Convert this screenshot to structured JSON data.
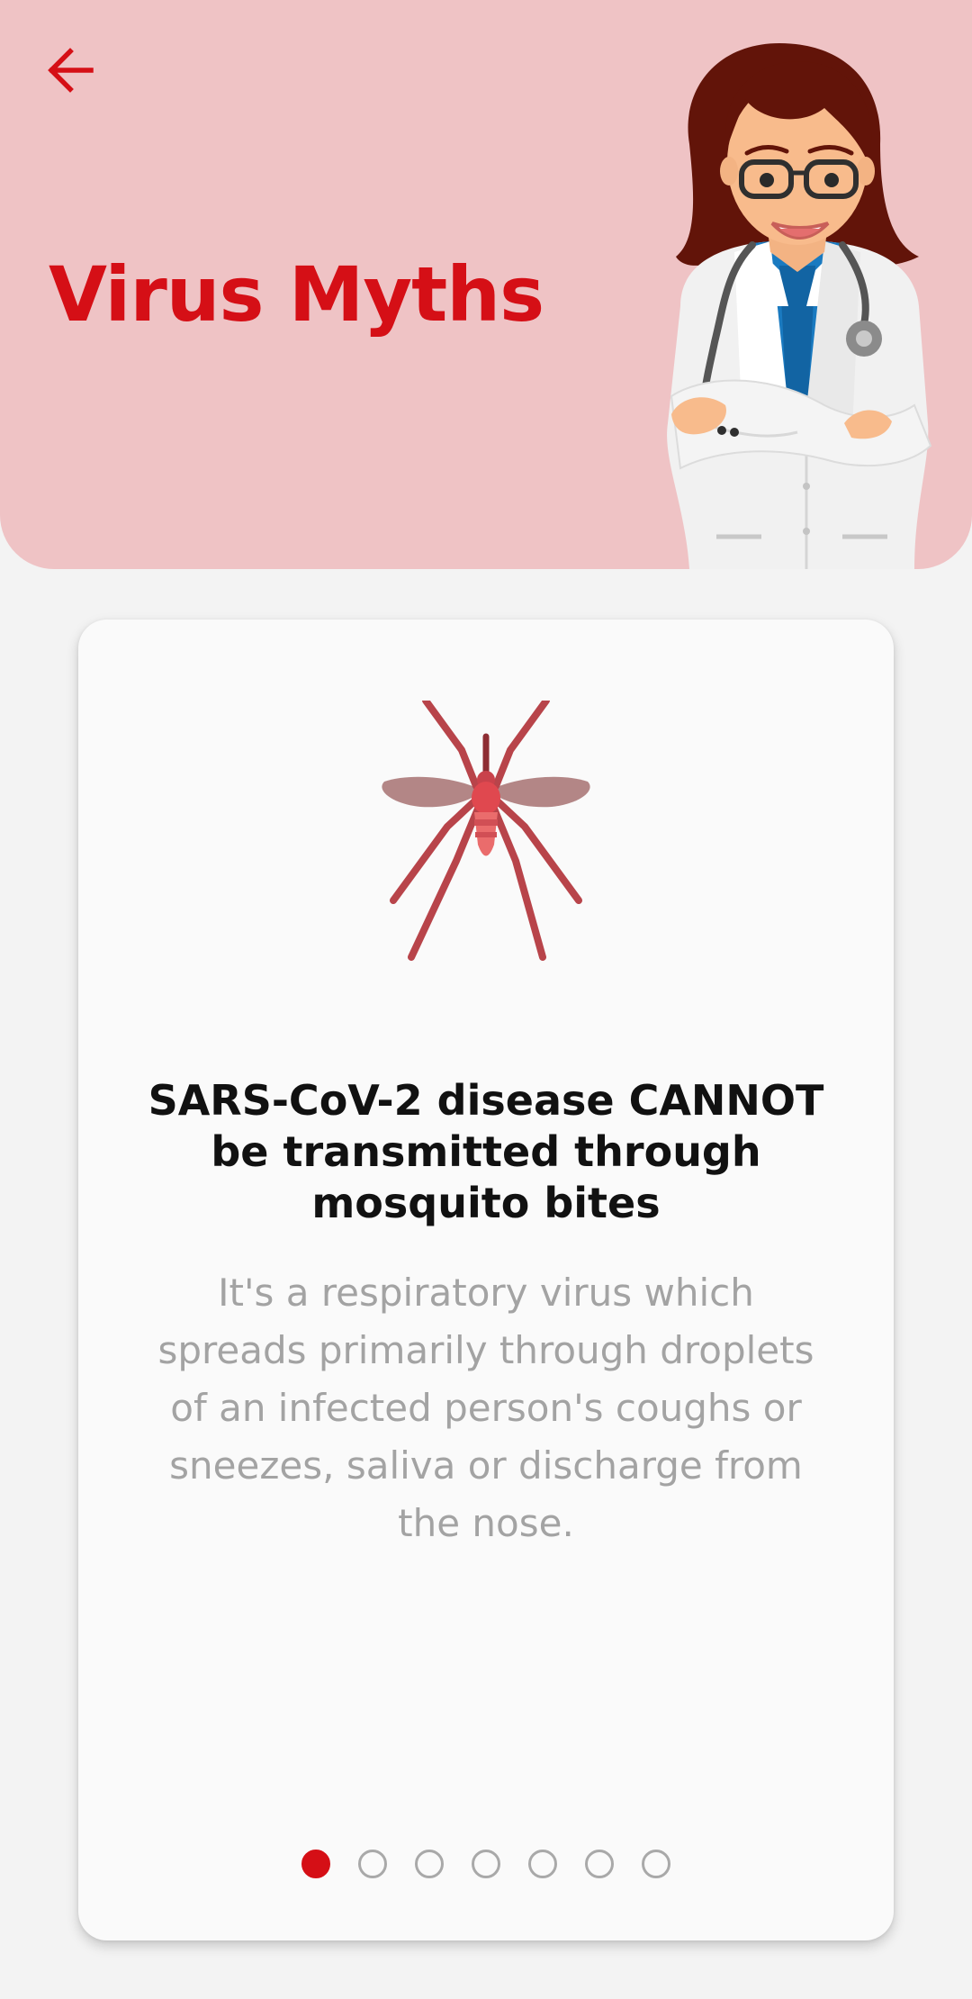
{
  "header": {
    "back_icon": "arrow-left-icon",
    "title": "Virus Myths",
    "illustration": "doctor-illustration",
    "background_color": "#efc3c5",
    "accent_color": "#d50f16"
  },
  "card": {
    "icon": "mosquito-icon",
    "title": "SARS-CoV-2 disease CANNOT be transmitted through mosquito bites",
    "body": "It's a respiratory virus which spreads primarily through droplets of an infected person's coughs or sneezes, saliva or discharge from the nose."
  },
  "pager": {
    "total": 7,
    "current": 1
  }
}
